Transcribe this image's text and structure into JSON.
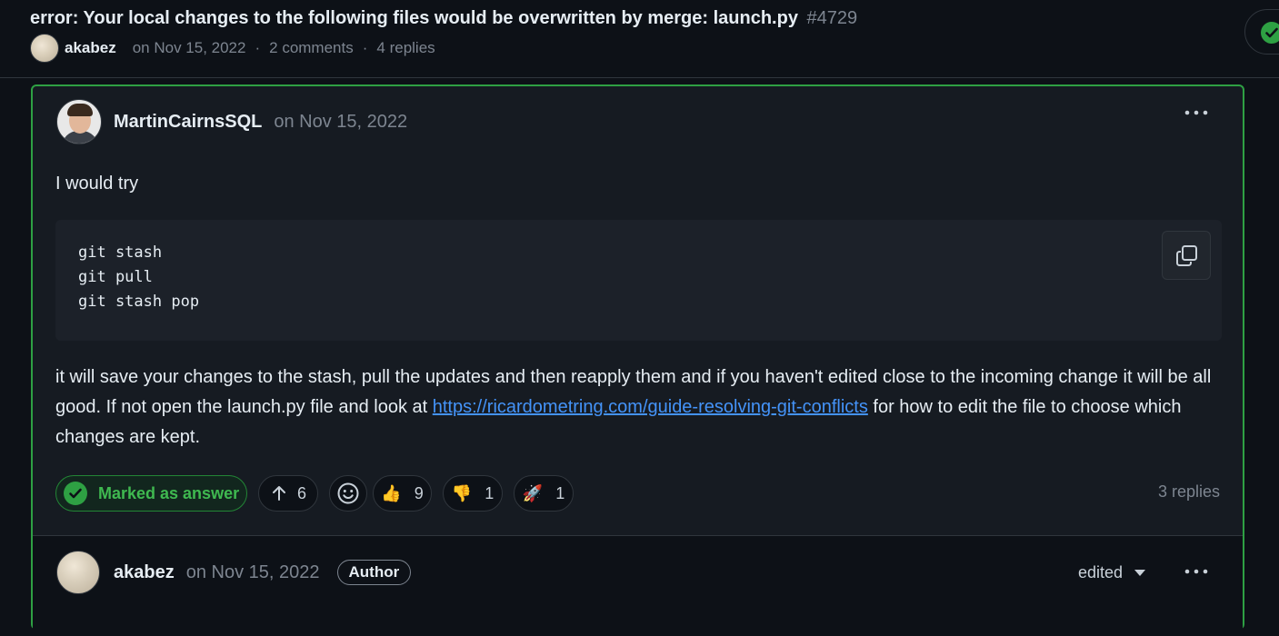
{
  "header": {
    "title": "error: Your local changes to the following files would be overwritten by merge: launch.py",
    "number": "#4729",
    "author": "akabez",
    "date": "on Nov 15, 2022",
    "separator": "·",
    "comments": "2 comments",
    "replies": "4 replies"
  },
  "answer": {
    "author": "MartinCairnsSQL",
    "date": "on Nov 15, 2022",
    "intro": "I would try",
    "code_lines": [
      "git stash",
      "git pull",
      "git stash pop"
    ],
    "para_before_link": "it will save your changes to the stash, pull the updates and then reapply them and if you haven't edited close to the incoming change it will be all good. If not open the launch.py file and look at ",
    "link_text": "https://ricardometring.com/guide-resolving-git-conflicts",
    "para_after_link": " for how to edit the file to choose which changes are kept.",
    "marked_label": "Marked as answer",
    "upvotes": "6",
    "reactions": [
      {
        "emoji": "👍",
        "count": "9"
      },
      {
        "emoji": "👎",
        "count": "1"
      },
      {
        "emoji": "🚀",
        "count": "1"
      }
    ],
    "replies_label": "3 replies"
  },
  "reply": {
    "author": "akabez",
    "date": "on Nov 15, 2022",
    "author_tag": "Author",
    "edited_label": "edited"
  },
  "colors": {
    "accent_green": "#2ea043",
    "link_blue": "#4493f8",
    "background": "#0d1117"
  }
}
